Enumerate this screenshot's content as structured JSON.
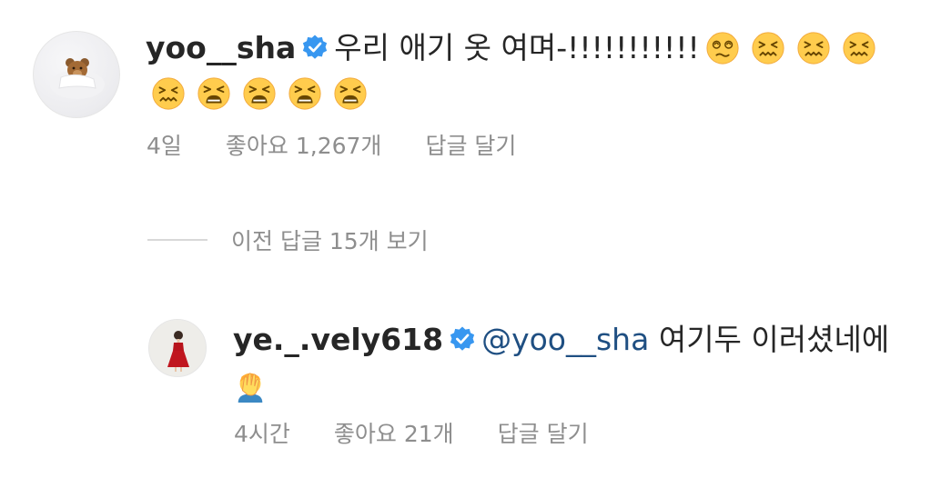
{
  "comments": [
    {
      "username": "yoo__sha",
      "text": "우리 애기 옷 여며-!!!!!!!!!!!",
      "emojis": [
        "dizzy-face",
        "confounded-face",
        "confounded-face",
        "confounded-face",
        "confounded-face",
        "tired-face",
        "tired-face",
        "tired-face",
        "tired-face"
      ],
      "time": "4일",
      "likes": "좋아요 1,267개",
      "reply": "답글 달기"
    }
  ],
  "replies_toggle": "이전 답글 15개 보기",
  "replies": [
    {
      "username": "ye._.vely618",
      "mention": "@yoo__sha",
      "text": "여기두 이러셨네에",
      "emojis": [
        "face-palm"
      ],
      "time": "4시간",
      "likes": "좋아요 21개",
      "reply": "답글 달기"
    }
  ],
  "colors": {
    "text": "#262626",
    "muted": "#8e8e8e",
    "verified": "#3897f0",
    "mention": "#1f4f82"
  }
}
